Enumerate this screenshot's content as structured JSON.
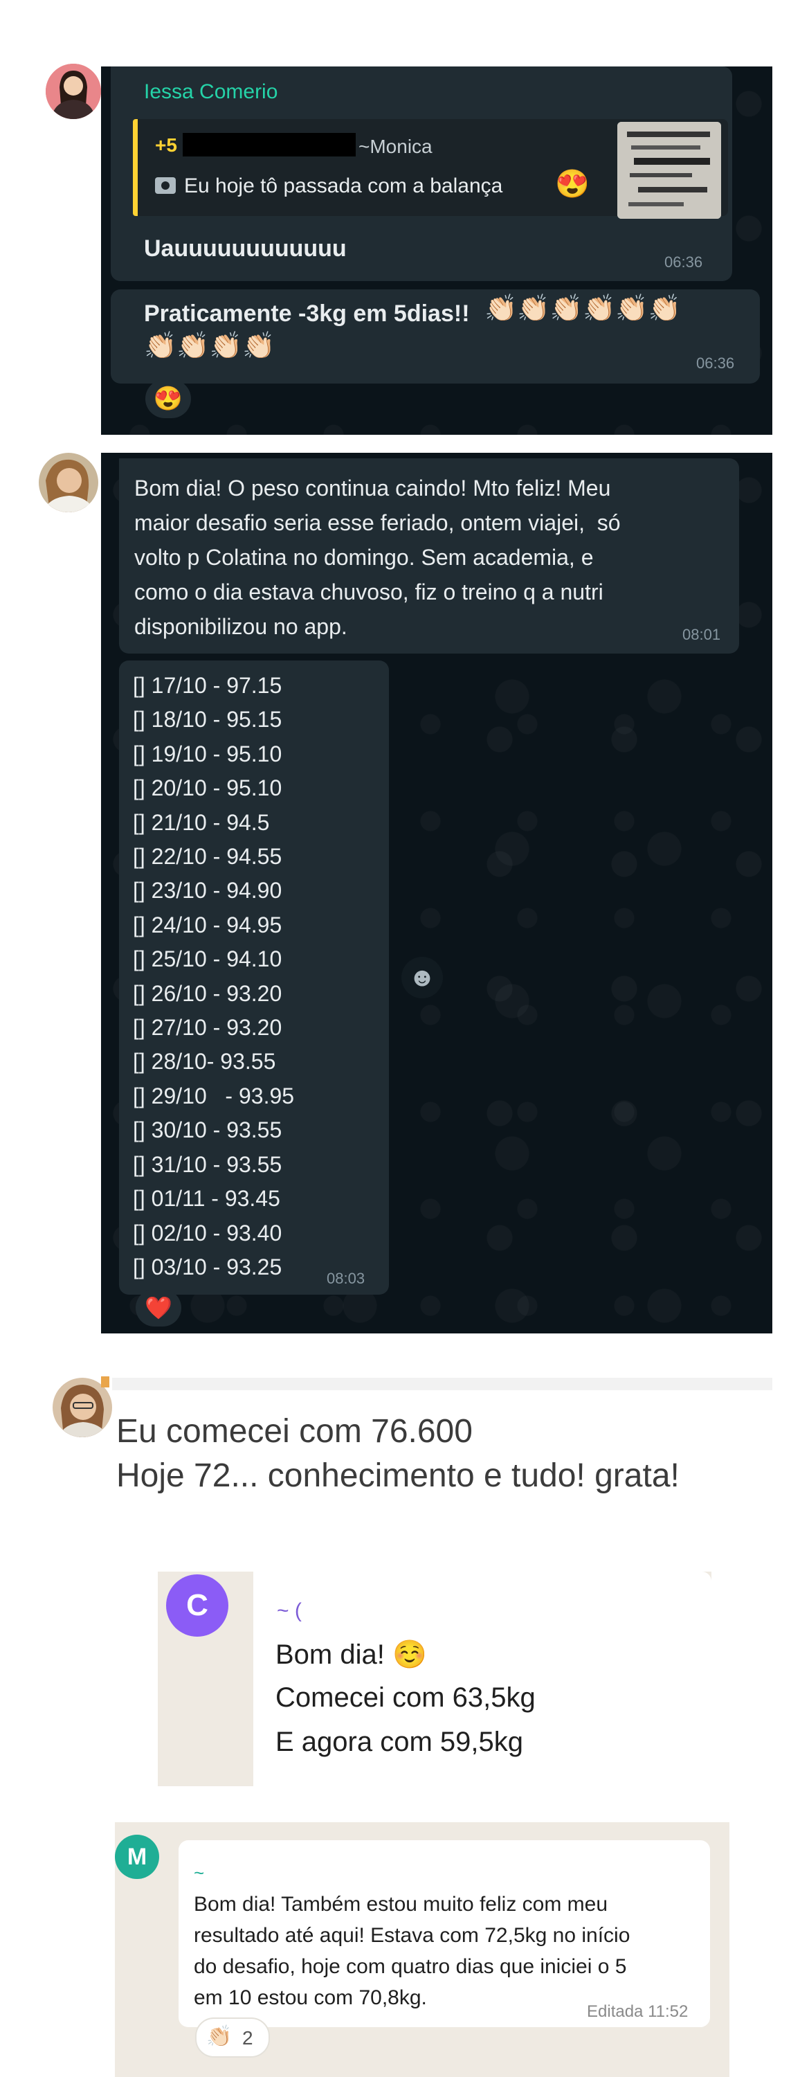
{
  "chat1": {
    "sender": "Iessa Comerio",
    "quote": {
      "phone": "+5",
      "name": "~Monica",
      "text": "Eu hoje tô passada com a balança",
      "emoji": "😍"
    },
    "msg1": {
      "text": "Uauuuuuuuuuuuu",
      "time": "06:36"
    },
    "msg2": {
      "text": "Praticamente -3kg em 5dias!!",
      "claps_row1": "👏🏻👏🏻👏🏻👏🏻👏🏻👏🏻",
      "claps_row2": "👏🏻👏🏻👏🏻👏🏻",
      "time": "06:36"
    },
    "reaction": "😍"
  },
  "chat2": {
    "message": [
      "Bom dia! O peso continua caindo! Mto feliz! Meu",
      "maior desafio seria esse feriado, ontem viajei,  só",
      "volto p Colatina no domingo. Sem academia, e",
      "como o dia estava chuvoso, fiz o treino q a nutri",
      "disponibilizou no app."
    ],
    "message_time": "08:01",
    "weights": [
      "[] 17/10 - 97.15",
      "[] 18/10 - 95.15",
      "[] 19/10 - 95.10",
      "[] 20/10 - 95.10",
      "[] 21/10 - 94.5",
      "[] 22/10 - 94.55",
      "[] 23/10 - 94.90",
      "[] 24/10 - 94.95",
      "[] 25/10 - 94.10",
      "[] 26/10 - 93.20",
      "[] 27/10 - 93.20",
      "[] 28/10- 93.55",
      "[] 29/10   - 93.95",
      "[] 30/10 - 93.55",
      "[] 31/10 - 93.55",
      "[] 01/11 - 93.45",
      "[] 02/10 - 93.40",
      "[] 03/10 - 93.25"
    ],
    "weights_time": "08:03",
    "reaction": "❤️",
    "side_emoji": "☻"
  },
  "chat3": {
    "line1": "Eu comecei com 76.600",
    "line2": "Hoje 72... conhecimento e tudo! grata!"
  },
  "chat4": {
    "avatar_letter": "C",
    "sender": "~ (",
    "line1": "Bom dia! ☺️",
    "line2": "Comecei com 63,5kg",
    "line3": "E agora com 59,5kg"
  },
  "chat5": {
    "avatar_letter": "M",
    "sender": "~",
    "lines": [
      "Bom dia! Também estou muito feliz com meu",
      "resultado até aqui! Estava com 72,5kg no início",
      "do desafio, hoje com quatro dias que iniciei o 5",
      "em 10 estou com 70,8kg."
    ],
    "edited": "Editada 11:52",
    "reaction_emoji": "👏🏻",
    "reaction_count": "2"
  }
}
